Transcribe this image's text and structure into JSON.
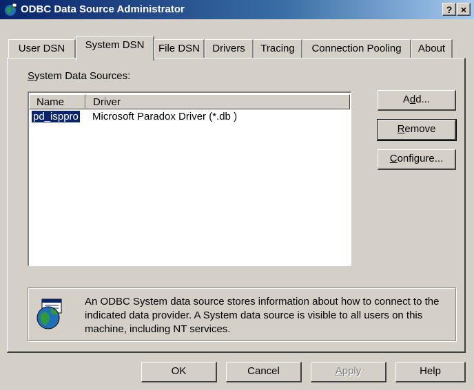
{
  "window": {
    "title": "ODBC Data Source Administrator",
    "help_button": "?",
    "close_button": "×"
  },
  "tabs": [
    {
      "label": "User DSN",
      "active": false
    },
    {
      "label": "System DSN",
      "active": true
    },
    {
      "label": "File DSN",
      "active": false
    },
    {
      "label": "Drivers",
      "active": false
    },
    {
      "label": "Tracing",
      "active": false
    },
    {
      "label": "Connection Pooling",
      "active": false
    },
    {
      "label": "About",
      "active": false
    }
  ],
  "system_dsn": {
    "list_label": {
      "mnemonic": "S",
      "rest": "ystem Data Sources:"
    },
    "columns": [
      "Name",
      "Driver"
    ],
    "rows": [
      {
        "name": "pd_isppro",
        "driver": "Microsoft Paradox Driver (*.db )",
        "selected": true
      }
    ],
    "buttons": {
      "add": {
        "pre": "A",
        "mnemonic": "d",
        "post": "d..."
      },
      "remove": {
        "pre": "",
        "mnemonic": "R",
        "post": "emove"
      },
      "configure": {
        "pre": "",
        "mnemonic": "C",
        "post": "onfigure..."
      }
    },
    "info_text": "An ODBC System data source stores information about how to connect to the indicated data provider.  A System data source is visible to all users on this machine, including NT services."
  },
  "footer_buttons": {
    "ok": "OK",
    "cancel": "Cancel",
    "apply": {
      "pre": "",
      "mnemonic": "A",
      "post": "pply"
    },
    "help": "Help"
  },
  "colors": {
    "titlebar_start": "#0a246a",
    "titlebar_end": "#a6caf0",
    "face": "#d4d0c8",
    "selection": "#0a246a"
  },
  "icons": [
    "odbc-app-icon",
    "odbc-globe-icon"
  ]
}
